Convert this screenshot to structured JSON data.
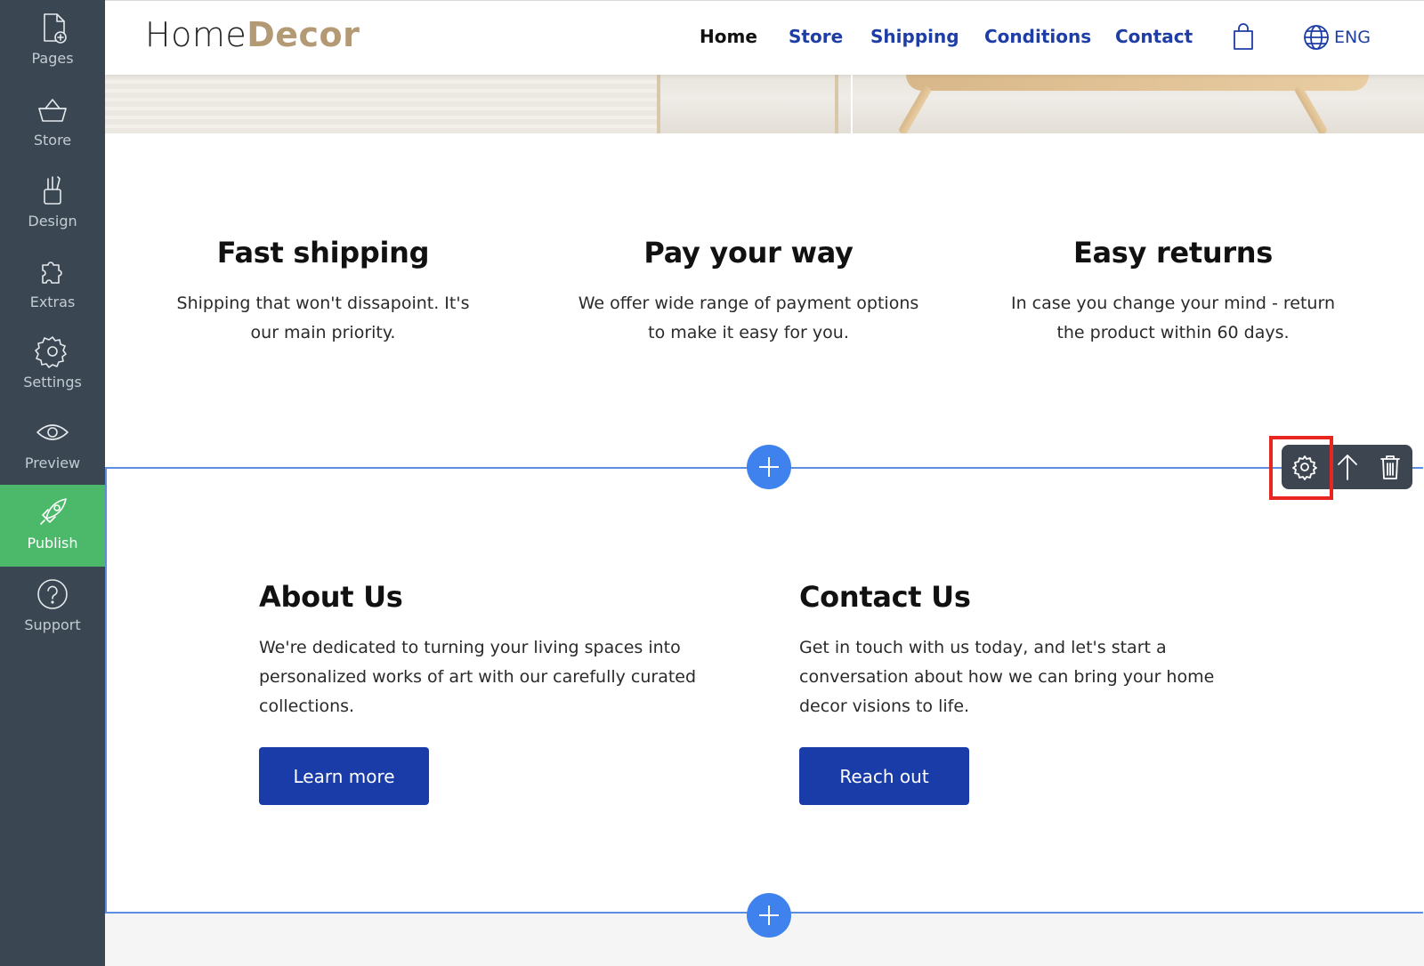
{
  "sidebar": {
    "items": [
      {
        "label": "Pages",
        "icon": "page-add-icon"
      },
      {
        "label": "Store",
        "icon": "basket-icon"
      },
      {
        "label": "Design",
        "icon": "design-tools-icon"
      },
      {
        "label": "Extras",
        "icon": "puzzle-icon"
      },
      {
        "label": "Settings",
        "icon": "gear-icon"
      },
      {
        "label": "Preview",
        "icon": "eye-icon"
      },
      {
        "label": "Publish",
        "icon": "rocket-icon",
        "active": true
      },
      {
        "label": "Support",
        "icon": "question-icon"
      }
    ]
  },
  "header": {
    "logo_part1": "Home",
    "logo_part2": "Decor",
    "nav": [
      "Home",
      "Store",
      "Shipping",
      "Conditions",
      "Contact"
    ],
    "language": "ENG"
  },
  "features": [
    {
      "title": "Fast shipping",
      "text": "Shipping that won't dissapoint. It's our main priority."
    },
    {
      "title": "Pay your way",
      "text": "We offer wide range of payment options to make it easy for you."
    },
    {
      "title": "Easy returns",
      "text": "In case you change your mind - return the product within 60 days."
    }
  ],
  "about": {
    "title": "About Us",
    "text": "We're dedicated to turning your living spaces into personalized works of art with our carefully curated collections.",
    "button": "Learn more"
  },
  "contact": {
    "title": "Contact Us",
    "text": "Get in touch with us today, and let's start a conversation about how we can bring your home decor visions to life.",
    "button": "Reach out"
  },
  "toolbar": {
    "icons": [
      "gear-icon",
      "arrow-up-icon",
      "trash-icon"
    ]
  },
  "colors": {
    "sidebar_bg": "#3a4651",
    "publish_green": "#4cb96a",
    "nav_blue": "#1e3ea6",
    "logo_tan": "#b39a75",
    "button_blue": "#1a3ca8",
    "plus_blue": "#3f82ee",
    "selection_outline": "#5d8ce0",
    "highlight_red": "#e8261f"
  }
}
